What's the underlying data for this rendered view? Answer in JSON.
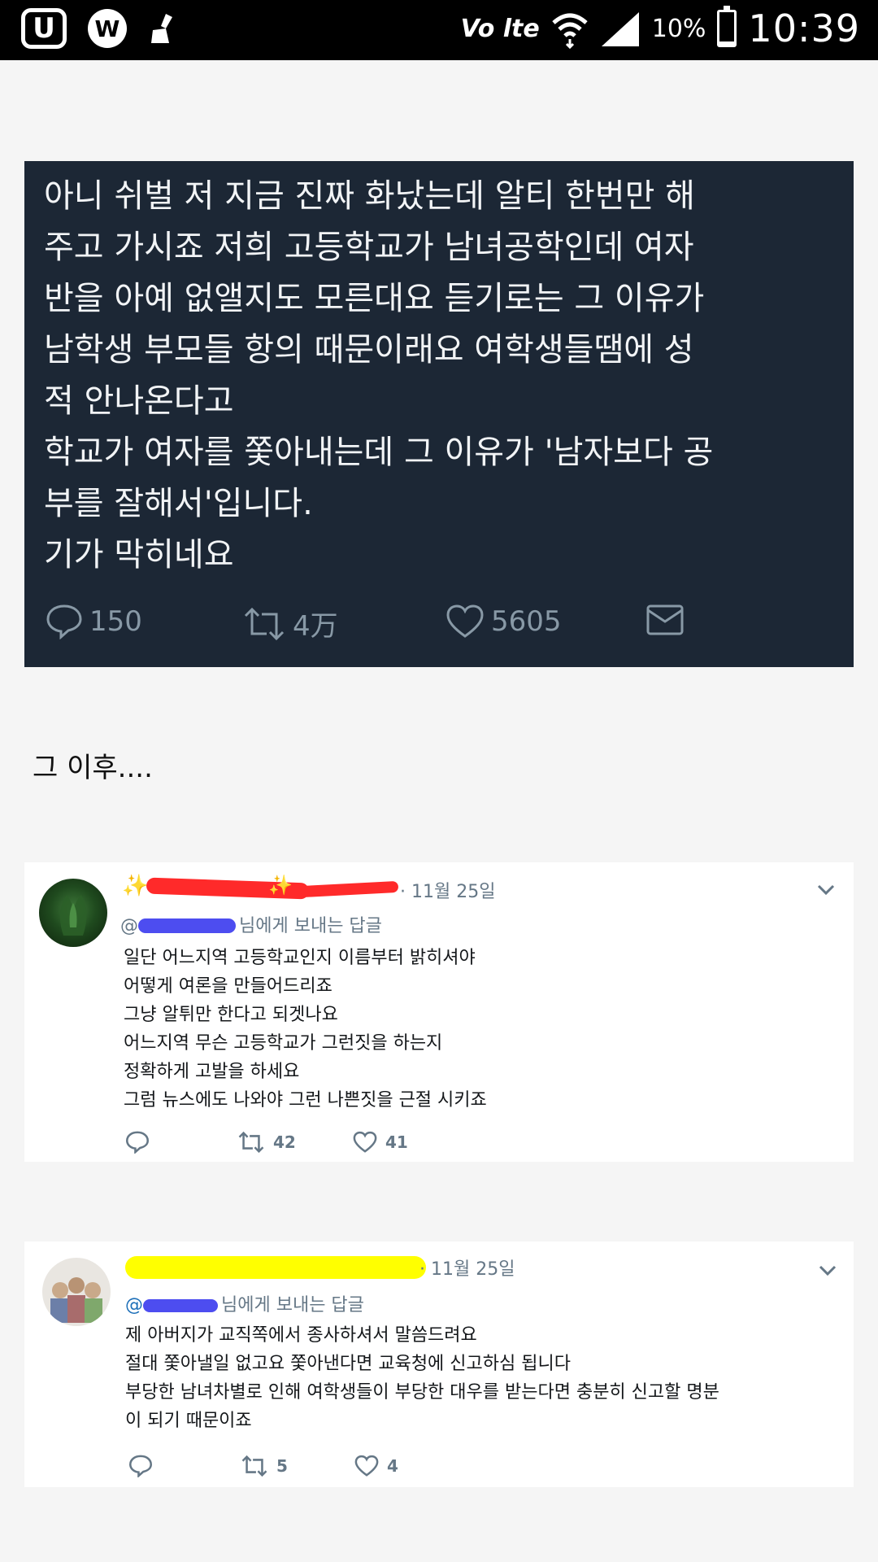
{
  "status_bar": {
    "left_icons": [
      "u-plus-icon",
      "w-circle-icon",
      "broom-icon"
    ],
    "u_label": "U",
    "w_label": "W",
    "network_label": "Vo lte",
    "battery_percent": "10%",
    "battery_level": 0.1,
    "time": "10:39"
  },
  "main_tweet": {
    "text": "아니 쉬벌 저 지금 진짜 화났는데 알티 한번만 해\n주고 가시죠 저희 고등학교가 남녀공학인데 여자\n반을 아예 없앨지도 모른대요 듣기로는 그 이유가\n남학생 부모들 항의 때문이래요 여학생들땜에 성\n적 안나온다고\n학교가 여자를 쫓아내는데 그 이유가 '남자보다 공\n부를 잘해서'입니다.\n기가 막히네요",
    "reply_count": "150",
    "retweet_count": "4万",
    "like_count": "5605",
    "colors": {
      "background": "#1c2735",
      "text": "#f2f4f6",
      "icon": "#8899a6"
    }
  },
  "after_label": "그 이후....",
  "replies": [
    {
      "date": "· 11월 25일",
      "reply_to": "님에게 보내는 답글",
      "reply_to_prefix": "@",
      "body": "일단 어느지역 고등학교인지 이름부터 밝히셔야\n어떻게 여론을 만들어드리죠\n그냥 알튀만 한다고 되겟나요\n어느지역 무슨 고등학교가 그런짓을 하는지\n정확하게 고발을 하세요\n그럼 뉴스에도 나와야 그런 나쁜짓을 근절 시키죠",
      "retweet_count": "42",
      "like_count": "41",
      "redaction_color": "#ff2a2a"
    },
    {
      "date": "· 11월 25일",
      "reply_to": "님에게 보내는 답글",
      "reply_to_prefix": "@",
      "body": "제 아버지가 교직쪽에서 종사하셔서 말씀드려요\n절대 쫓아낼일 없고요 쫓아낸다면 교육청에 신고하심 됩니다\n부당한 남녀차별로 인해 여학생들이 부당한 대우를 받는다면 충분히 신고할 명분\n이 되기 때문이죠",
      "retweet_count": "5",
      "like_count": "4",
      "redaction_color": "#ffff00"
    }
  ]
}
